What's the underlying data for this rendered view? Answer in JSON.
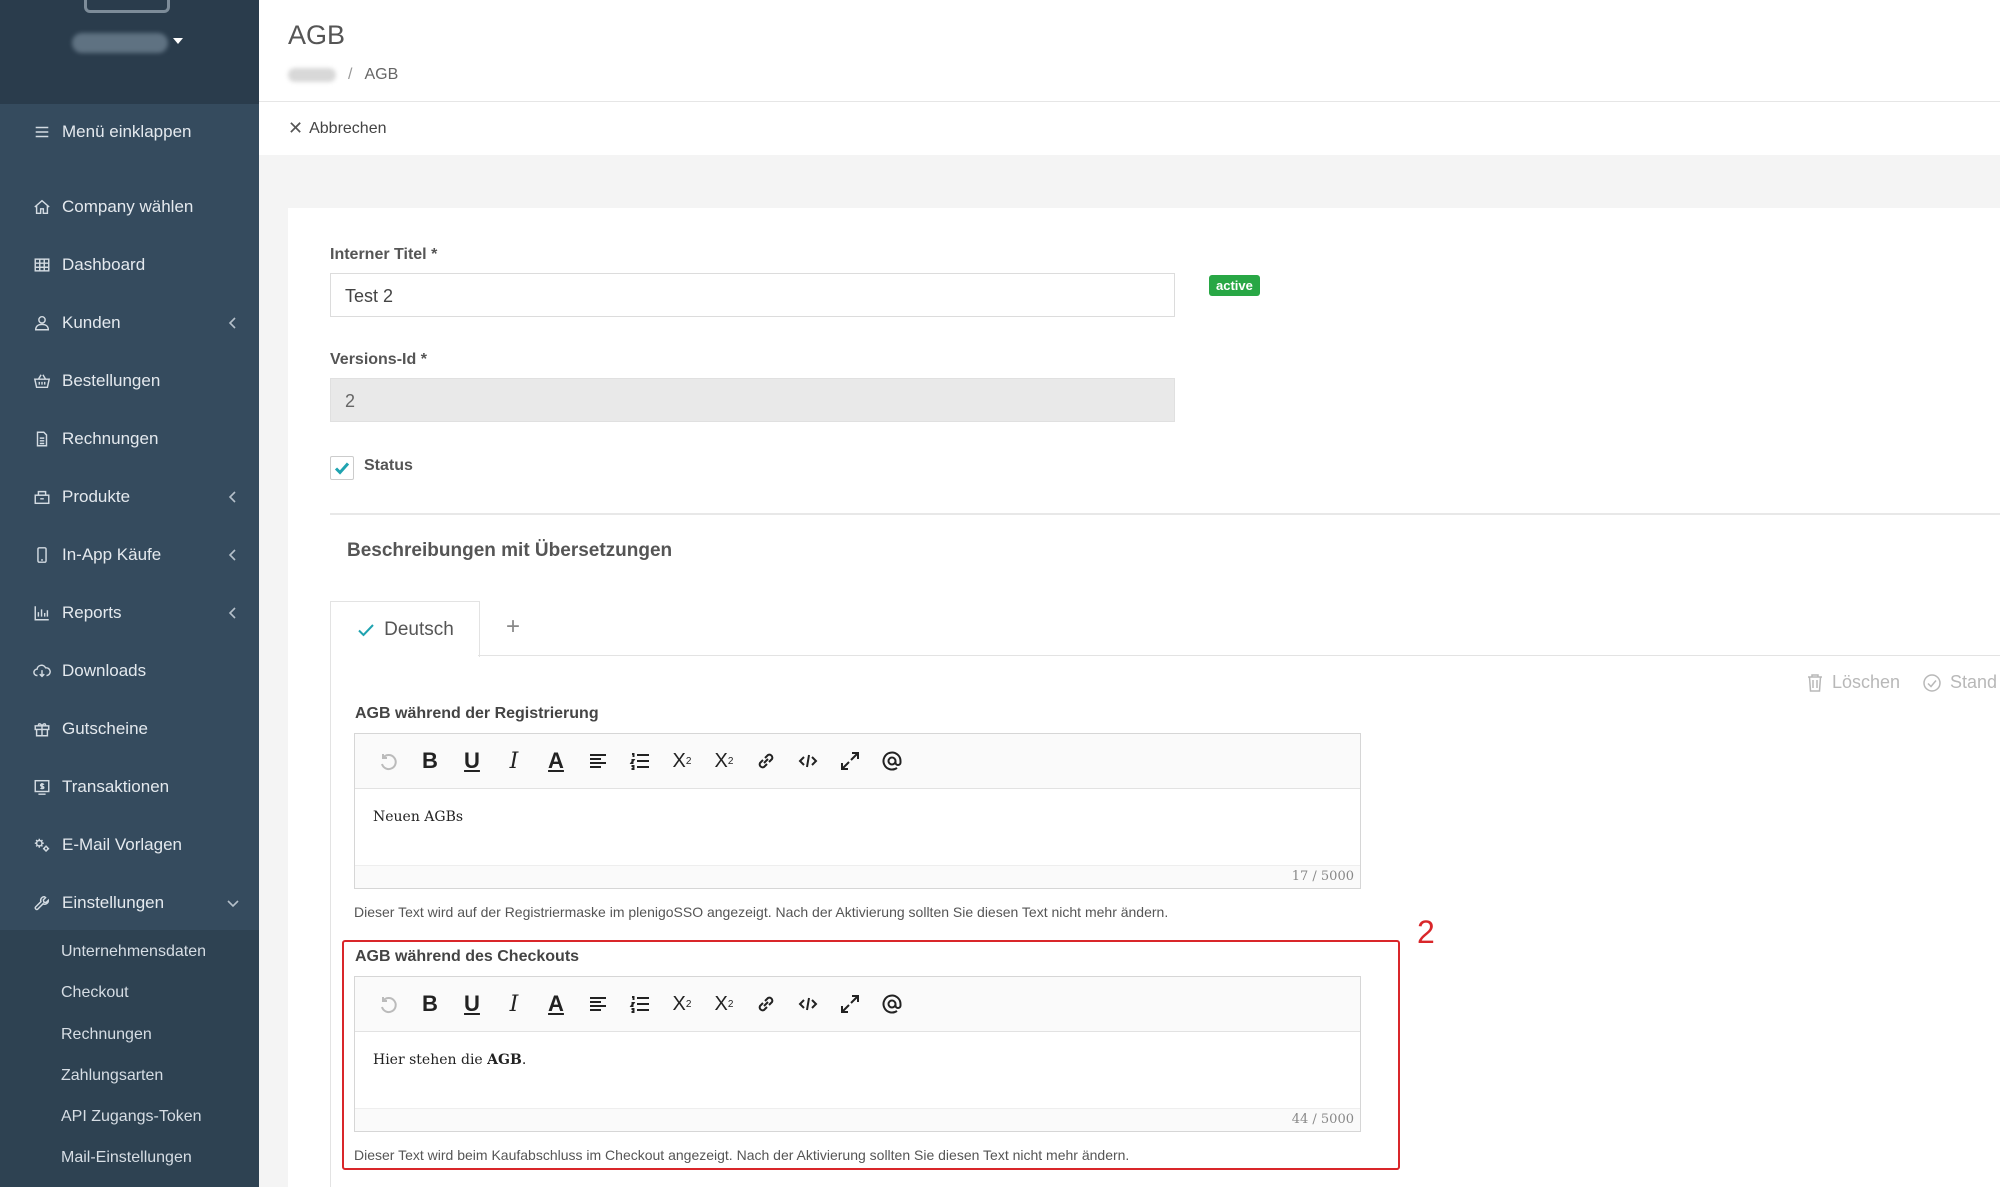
{
  "sidebar": {
    "user_name": "",
    "collapse_label": "Menü einklappen",
    "items": [
      {
        "label": "Company wählen",
        "icon": "home-icon"
      },
      {
        "label": "Dashboard",
        "icon": "table-icon"
      },
      {
        "label": "Kunden",
        "icon": "user-icon"
      },
      {
        "label": "Bestellungen",
        "icon": "basket-icon"
      },
      {
        "label": "Rechnungen",
        "icon": "file-icon"
      },
      {
        "label": "Produkte",
        "icon": "box-icon"
      },
      {
        "label": "In-App Käufe",
        "icon": "phone-icon"
      },
      {
        "label": "Reports",
        "icon": "bar-chart-icon"
      },
      {
        "label": "Downloads",
        "icon": "cloud-download-icon"
      },
      {
        "label": "Gutscheine",
        "icon": "gift-icon"
      },
      {
        "label": "Transaktionen",
        "icon": "dollar-icon"
      },
      {
        "label": "E-Mail Vorlagen",
        "icon": "cogs-icon"
      },
      {
        "label": "Einstellungen",
        "icon": "wrench-icon"
      }
    ],
    "subitems": [
      "Unternehmensdaten",
      "Checkout",
      "Rechnungen",
      "Zahlungsarten",
      "API Zugangs-Token",
      "Mail-Einstellungen"
    ]
  },
  "header": {
    "title": "AGB",
    "breadcrumb_sep": "/",
    "breadcrumb_current": "AGB"
  },
  "toolbar": {
    "cancel_label": "Abbrechen"
  },
  "form": {
    "title_label": "Interner Titel *",
    "title_value": "Test 2",
    "badge": "active",
    "version_label": "Versions-Id *",
    "version_value": "2",
    "status_label": "Status",
    "status_checked": true,
    "section_title": "Beschreibungen mit Übersetzungen",
    "tab_label": "Deutsch",
    "tab_add": "+",
    "delete_label": "Löschen",
    "default_label": "Stand"
  },
  "editors": {
    "registration": {
      "label": "AGB während der Registrierung",
      "content": "Neuen AGBs",
      "count": "17 / 5000",
      "help": "Dieser Text wird auf der Registriermaske im plenigoSSO angezeigt. Nach der Aktivierung sollten Sie diesen Text nicht mehr ändern."
    },
    "checkout": {
      "label": "AGB während des Checkouts",
      "content_pre": "Hier stehen die ",
      "content_bold": "AGB",
      "content_post": ".",
      "count": "44 / 5000",
      "help": "Dieser Text wird beim Kaufabschluss im Checkout angezeigt. Nach der Aktivierung sollten Sie diesen Text nicht mehr ändern."
    }
  },
  "annotation": {
    "marker": "2",
    "color": "#d9262a"
  },
  "colors": {
    "sidebar": "#354b5e",
    "sidebar_top": "#2a3c4c",
    "accent": "#1fa3b0",
    "badge": "#28a745"
  }
}
